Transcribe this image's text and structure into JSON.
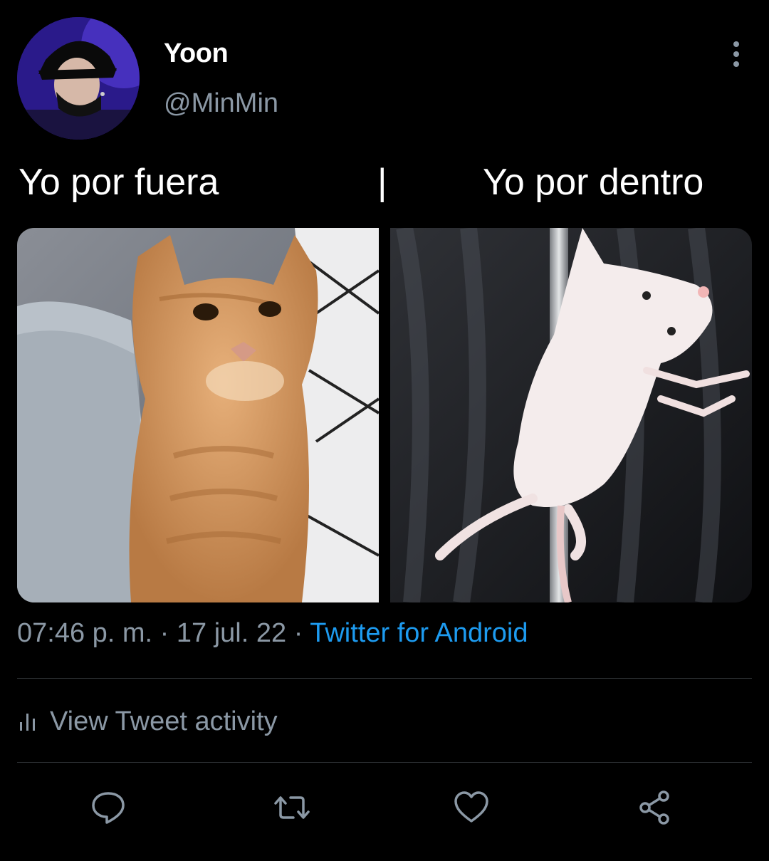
{
  "author": {
    "display_name": "Yoon",
    "handle": "@MinMin",
    "avatar_icon": "profile-photo"
  },
  "tweet": {
    "text_left": "Yo por fuera",
    "text_separator": "|",
    "text_right": "Yo por dentro",
    "media": [
      {
        "name": "orange-cat-photo"
      },
      {
        "name": "white-rat-pole-photo"
      }
    ]
  },
  "meta": {
    "time": "07:46 p. m.",
    "sep1": " · ",
    "date": "17 jul. 22",
    "sep2": " · ",
    "source": "Twitter for Android"
  },
  "activity": {
    "label": "View Tweet activity",
    "icon": "bar-chart-icon"
  },
  "actions": [
    {
      "name": "reply",
      "icon": "reply-icon"
    },
    {
      "name": "retweet",
      "icon": "retweet-icon"
    },
    {
      "name": "like",
      "icon": "heart-icon"
    },
    {
      "name": "share",
      "icon": "share-icon"
    }
  ],
  "colors": {
    "background": "#000000",
    "text": "#ffffff",
    "secondary": "#8b98a5",
    "link": "#1d9bf0",
    "divider": "#2f3336"
  }
}
